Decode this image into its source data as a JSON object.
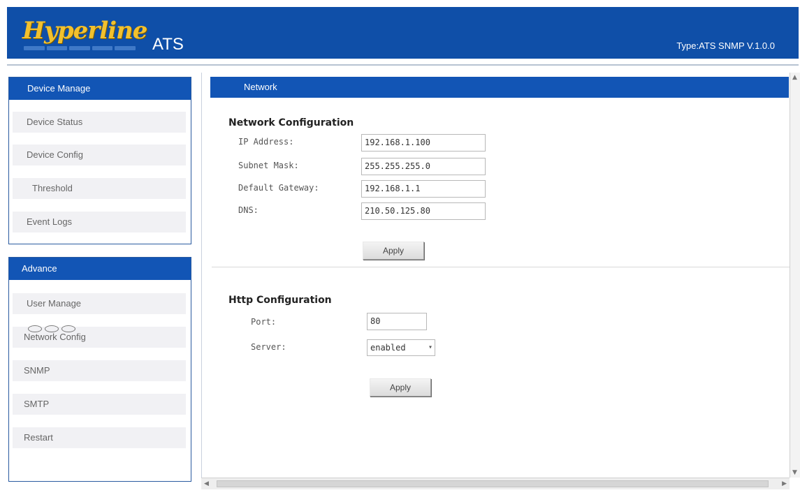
{
  "header": {
    "logo_text": "Hyperline",
    "product": "ATS",
    "type_label": "Type:ATS SNMP V.1.0.0"
  },
  "sidebar": {
    "device_manage": {
      "title": "Device Manage",
      "items": [
        {
          "label": "Device Status"
        },
        {
          "label": "Device Config"
        },
        {
          "label": "Threshold"
        },
        {
          "label": "Event Logs"
        }
      ]
    },
    "advance": {
      "title": "Advance",
      "items": [
        {
          "label": "User Manage"
        },
        {
          "label": "Network Config"
        },
        {
          "label": "SNMP"
        },
        {
          "label": "SMTP"
        },
        {
          "label": "Restart"
        }
      ]
    }
  },
  "main": {
    "title": "Network",
    "network_config": {
      "title": "Network Configuration",
      "fields": [
        {
          "label": "IP Address:",
          "value": "192.168.1.100"
        },
        {
          "label": "Subnet Mask:",
          "value": "255.255.255.0"
        },
        {
          "label": "Default Gateway:",
          "value": "192.168.1.1"
        },
        {
          "label": "DNS:",
          "value": "210.50.125.80"
        }
      ],
      "apply_label": "Apply"
    },
    "http_config": {
      "title": "Http Configuration",
      "port_label": "Port:",
      "port_value": "80",
      "server_label": "Server:",
      "server_value": "enabled",
      "apply_label": "Apply"
    }
  },
  "colors": {
    "header_bg": "#0f4fa8",
    "panel_head_bg": "#1255b5",
    "logo_yellow": "#f2c12e"
  }
}
